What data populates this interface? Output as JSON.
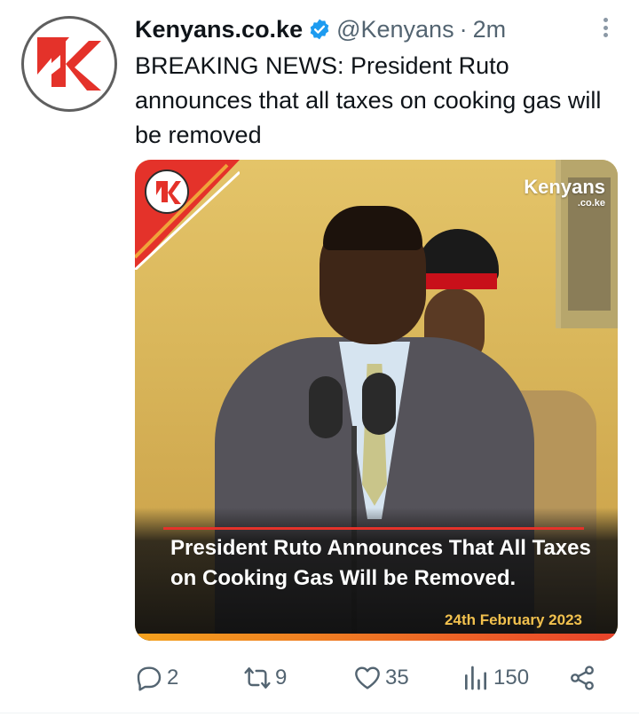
{
  "tweet": {
    "author": {
      "display_name": "Kenyans.co.ke",
      "handle": "@Kenyans",
      "verified": true,
      "avatar_icon": "kenyans-k-logo"
    },
    "separator": "·",
    "timestamp": "2m",
    "text": "BREAKING NEWS: President Ruto announces that all taxes on cooking gas will be removed",
    "media": {
      "brand_wordmark": "Kenyans",
      "brand_wordmark_sub": ".co.ke",
      "caption": "President Ruto Announces That All Taxes on Cooking Gas Will be Removed.",
      "caption_date": "24th February 2023"
    },
    "actions": {
      "replies": "2",
      "retweets": "9",
      "likes": "35",
      "views": "150"
    }
  },
  "colors": {
    "brand_red": "#e4322a",
    "verified_blue": "#1d9bf0",
    "muted_text": "#536471",
    "caption_date": "#f2c14e"
  },
  "icons": {
    "more": "more-vertical-icon",
    "verified": "verified-badge-icon",
    "reply": "reply-icon",
    "retweet": "retweet-icon",
    "like": "heart-icon",
    "views": "views-bar-chart-icon",
    "share": "share-icon"
  }
}
